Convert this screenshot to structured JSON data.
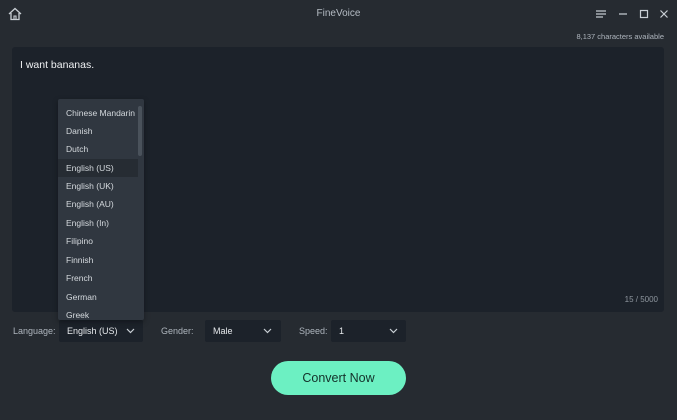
{
  "window": {
    "title": "FineVoice",
    "icons": {
      "home": "home-icon",
      "menu": "menu-icon",
      "minimize": "minimize-icon",
      "maximize": "maximize-icon",
      "close": "close-icon"
    }
  },
  "editor": {
    "characters_available": "8,137 characters available",
    "text": "I want bananas.",
    "char_count": "15 / 5000"
  },
  "language": {
    "label": "Language:",
    "selected": "English (US)",
    "options": [
      "Chinese Mandarin",
      "Danish",
      "Dutch",
      "English (US)",
      "English (UK)",
      "English (AU)",
      "English (In)",
      "Filipino",
      "Finnish",
      "French",
      "German",
      "Greek"
    ]
  },
  "gender": {
    "label": "Gender:",
    "selected": "Male"
  },
  "speed": {
    "label": "Speed:",
    "selected": "1"
  },
  "convert_label": "Convert Now",
  "colors": {
    "background": "#262b31",
    "panel": "#1c222a",
    "accent": "#6cf0c2",
    "dropdown": "#303740"
  }
}
